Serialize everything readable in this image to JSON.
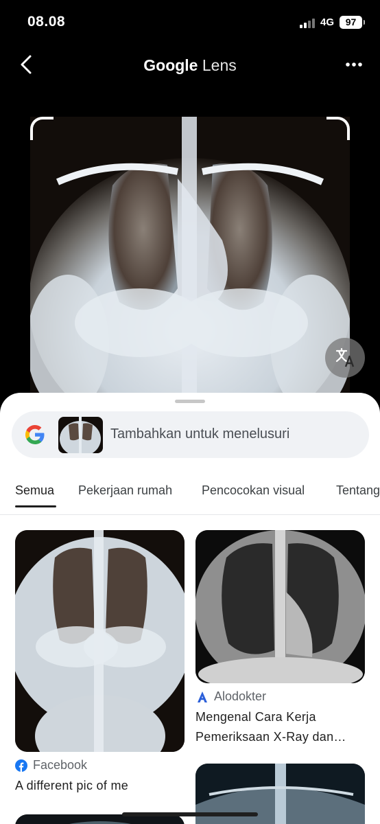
{
  "status_bar": {
    "time": "08.08",
    "network": "4G",
    "battery": "97"
  },
  "header": {
    "title_google": "Google",
    "title_lens": "Lens"
  },
  "search": {
    "placeholder": "Tambahkan untuk menelusuri"
  },
  "tabs": [
    {
      "label": "Semua"
    },
    {
      "label": "Pekerjaan rumah"
    },
    {
      "label": "Pencocokan visual"
    },
    {
      "label": "Tentang"
    }
  ],
  "results": [
    {
      "source": "Facebook",
      "title": "A different pic of me"
    },
    {
      "source": "Alodokter",
      "title_line1": "Mengenal Cara Kerja",
      "title_line2": "Pemeriksaan X-Ray dan…"
    }
  ],
  "colors": {
    "facebook": "#1877f2",
    "alodokter": "#2b5fd9",
    "sheet": "#ffffff",
    "search_bg": "#f0f2f5"
  },
  "icons": [
    "back-icon",
    "more-icon",
    "translate-icon",
    "google-icon",
    "facebook-icon",
    "alodokter-icon"
  ]
}
